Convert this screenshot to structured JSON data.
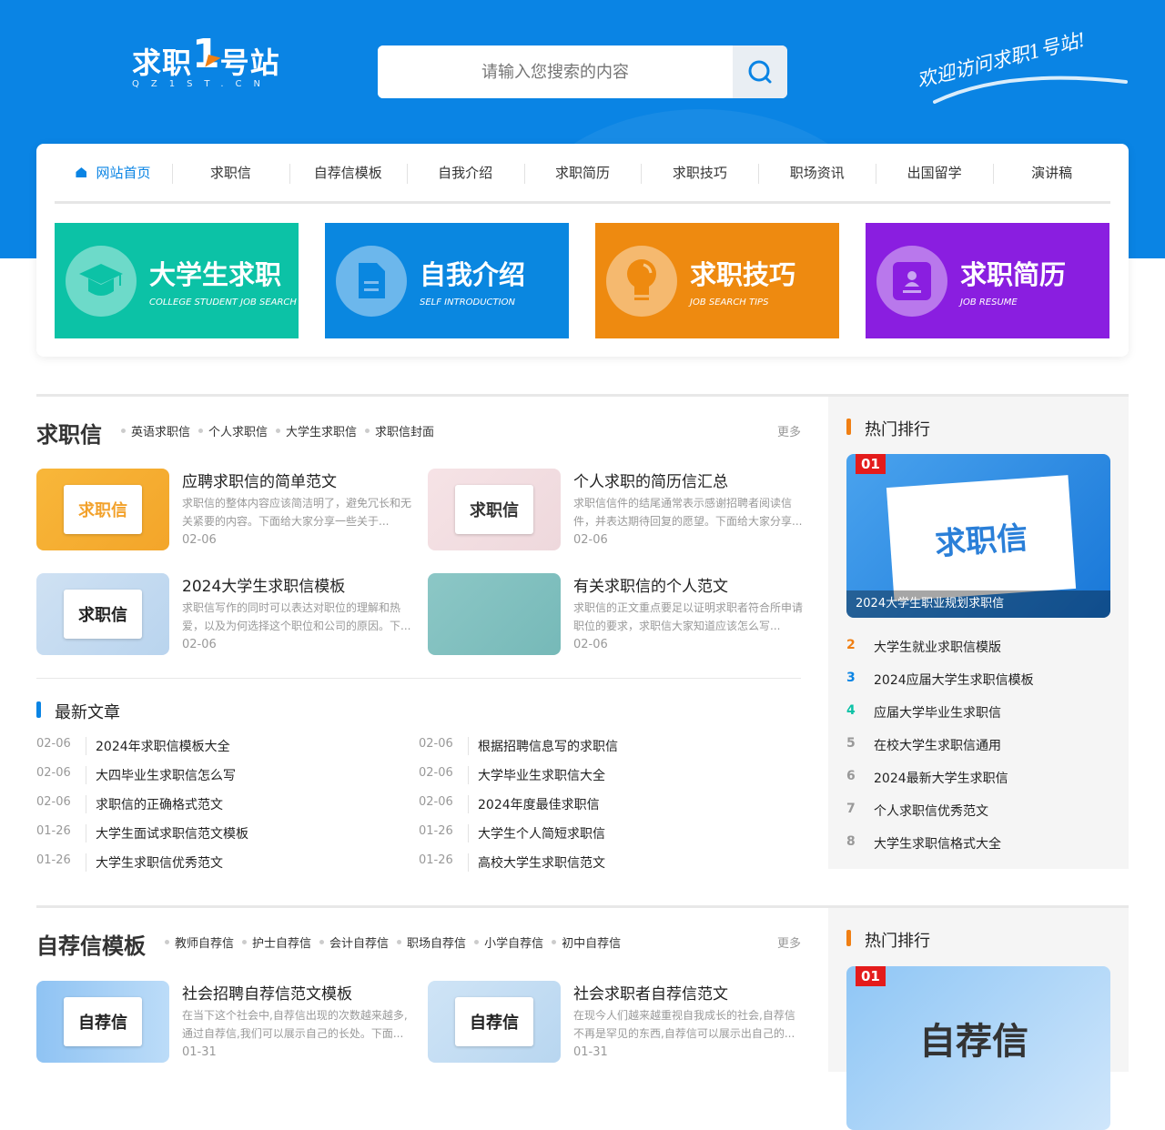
{
  "header": {
    "logo_text": "求职",
    "logo_one": "1",
    "logo_text2": "号站",
    "logo_domain": "QZ1ST.CN",
    "search_placeholder": "请输入您搜索的内容",
    "welcome": "欢迎访问求职1号站!"
  },
  "nav": [
    "网站首页",
    "求职信",
    "自荐信模板",
    "自我介绍",
    "求职简历",
    "求职技巧",
    "职场资讯",
    "出国留学",
    "演讲稿"
  ],
  "banners": [
    {
      "title": "大学生求职",
      "en": "COLLEGE STUDENT JOB SEARCH",
      "color": "#0cc2a6",
      "icon": "graduation-cap-icon"
    },
    {
      "title": "自我介绍",
      "en": "SELF INTRODUCTION",
      "color": "#0a87e0",
      "icon": "document-icon"
    },
    {
      "title": "求职技巧",
      "en": "JOB SEARCH TIPS",
      "color": "#ee8a10",
      "icon": "lightbulb-icon"
    },
    {
      "title": "求职简历",
      "en": "JOB RESUME",
      "color": "#8a1ee0",
      "icon": "resume-icon"
    }
  ],
  "section1": {
    "title": "求职信",
    "tags": [
      "英语求职信",
      "个人求职信",
      "大学生求职信",
      "求职信封面"
    ],
    "more": "更多",
    "articles": [
      {
        "img_text": "求职信",
        "title": "应聘求职信的简单范文",
        "desc": "求职信的整体内容应该简洁明了，避免冗长和无关紧要的内容。下面给大家分享一些关于...",
        "date": "02-06"
      },
      {
        "img_text": "求职信",
        "title": "个人求职的简历信汇总",
        "desc": "求职信信件的结尾通常表示感谢招聘者阅读信件，并表达期待回复的愿望。下面给大家分享...",
        "date": "02-06"
      },
      {
        "img_text": "求职信",
        "title": "2024大学生求职信模板",
        "desc": "求职信写作的同时可以表达对职位的理解和热爱，以及为何选择这个职位和公司的原因。下...",
        "date": "02-06"
      },
      {
        "img_text": "",
        "title": "有关求职信的个人范文",
        "desc": "求职信的正文重点要足以证明求职者符合所申请职位的要求，求职信大家知道应该怎么写...",
        "date": "02-06"
      }
    ],
    "latest_title": "最新文章",
    "latest": [
      {
        "date": "02-06",
        "title": "2024年求职信模板大全"
      },
      {
        "date": "02-06",
        "title": "根据招聘信息写的求职信"
      },
      {
        "date": "02-06",
        "title": "大四毕业生求职信怎么写"
      },
      {
        "date": "02-06",
        "title": "大学毕业生求职信大全"
      },
      {
        "date": "02-06",
        "title": "求职信的正确格式范文"
      },
      {
        "date": "02-06",
        "title": "2024年度最佳求职信"
      },
      {
        "date": "01-26",
        "title": "大学生面试求职信范文模板"
      },
      {
        "date": "01-26",
        "title": "大学生个人简短求职信"
      },
      {
        "date": "01-26",
        "title": "大学生求职信优秀范文"
      },
      {
        "date": "01-26",
        "title": "高校大学生求职信范文"
      }
    ],
    "hot_title": "热门排行",
    "hot_top": {
      "rank": "01",
      "img_text": "求职信",
      "caption": "2024大学生职业规划求职信"
    },
    "hot": [
      {
        "n": "2",
        "t": "大学生就业求职信模版"
      },
      {
        "n": "3",
        "t": "2024应届大学生求职信模板"
      },
      {
        "n": "4",
        "t": "应届大学毕业生求职信"
      },
      {
        "n": "5",
        "t": "在校大学生求职信通用"
      },
      {
        "n": "6",
        "t": "2024最新大学生求职信"
      },
      {
        "n": "7",
        "t": "个人求职信优秀范文"
      },
      {
        "n": "8",
        "t": "大学生求职信格式大全"
      }
    ],
    "rank_colors": [
      "#f07f13",
      "#0a84e4",
      "#0cc2a6",
      "#999999"
    ]
  },
  "section2": {
    "title": "自荐信模板",
    "tags": [
      "教师自荐信",
      "护士自荐信",
      "会计自荐信",
      "职场自荐信",
      "小学自荐信",
      "初中自荐信"
    ],
    "more": "更多",
    "articles": [
      {
        "img_text": "自荐信",
        "title": "社会招聘自荐信范文模板",
        "desc": "在当下这个社会中,自荐信出现的次数越来越多,通过自荐信,我们可以展示自己的长处。下面...",
        "date": "01-31"
      },
      {
        "img_text": "自荐信",
        "title": "社会求职者自荐信范文",
        "desc": "在现今人们越来越重视自我成长的社会,自荐信不再是罕见的东西,自荐信可以展示出自己的...",
        "date": "01-31"
      }
    ],
    "hot_title": "热门排行",
    "hot_top": {
      "rank": "01",
      "img_text": "自荐信"
    }
  }
}
